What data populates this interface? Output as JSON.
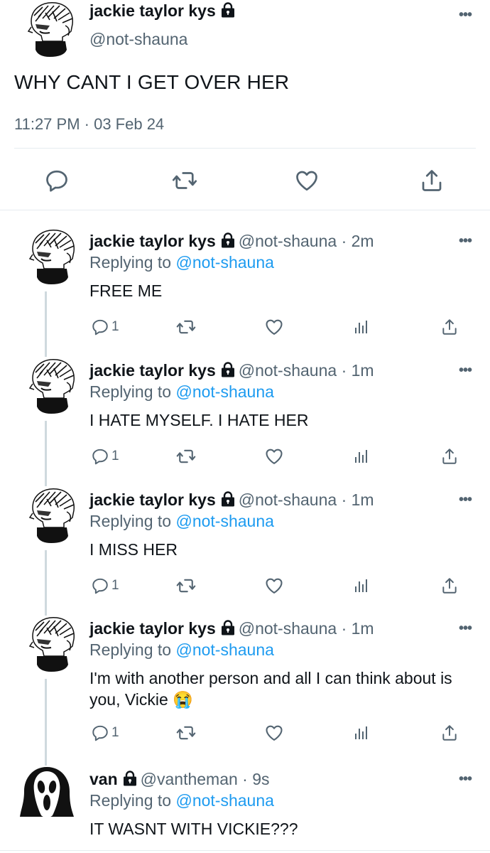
{
  "main_tweet": {
    "display_name": "jackie taylor kys",
    "handle": "@not-shauna",
    "text": "WHY CANT I GET OVER HER",
    "timestamp": "11:27 PM · 03 Feb 24",
    "more": "•••"
  },
  "replies": [
    {
      "display_name": "jackie taylor kys",
      "handle_time": "@not-shauna · 2m",
      "replying_prefix": "Replying to ",
      "replying_to": "@not-shauna",
      "text": "FREE ME",
      "reply_count": "1",
      "more": "•••"
    },
    {
      "display_name": "jackie taylor kys",
      "handle_time": "@not-shauna · 1m",
      "replying_prefix": "Replying to ",
      "replying_to": "@not-shauna",
      "text": "I HATE MYSELF. I HATE HER",
      "reply_count": "1",
      "more": "•••"
    },
    {
      "display_name": "jackie taylor kys",
      "handle_time": "@not-shauna · 1m",
      "replying_prefix": "Replying to ",
      "replying_to": "@not-shauna",
      "text": "I MISS HER",
      "reply_count": "1",
      "more": "•••"
    },
    {
      "display_name": "jackie taylor kys",
      "handle_time": "@not-shauna · 1m",
      "replying_prefix": "Replying to ",
      "replying_to": "@not-shauna",
      "text": "I'm with another person and all I can think about is you, Vickie 😭",
      "reply_count": "1",
      "more": "•••"
    },
    {
      "display_name": "van",
      "handle_time": "@vantheman · 9s",
      "replying_prefix": "Replying to ",
      "replying_to": "@not-shauna",
      "text": "IT WASNT WITH VICKIE???",
      "more": "•••"
    }
  ],
  "icons": {
    "reply": "reply-icon",
    "retweet": "retweet-icon",
    "like": "heart-icon",
    "analytics": "analytics-icon",
    "share": "share-icon",
    "lock": "lock-icon"
  },
  "colors": {
    "link": "#1d9bf0",
    "secondary_text": "#536471",
    "divider": "#e6ecf0",
    "thread_line": "#cfd9de"
  }
}
